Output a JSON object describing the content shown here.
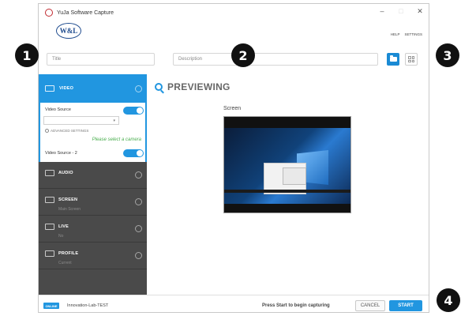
{
  "window": {
    "title": "YuJa Software Capture",
    "controls": {
      "minimize": "–",
      "maximize": "□",
      "close": "✕"
    }
  },
  "logo": {
    "text": "W&L"
  },
  "top_links": {
    "help": "HELP",
    "settings": "SETTINGS"
  },
  "fields": {
    "title_placeholder": "Title",
    "description_placeholder": "Description"
  },
  "sidebar": {
    "video": {
      "label": "VIDEO",
      "source_label": "Video Source",
      "source_enabled": true,
      "advanced_label": "ADVANCED SETTINGS",
      "camera_hint": "Please select a camera",
      "source2_label": "Video Source - 2",
      "source2_enabled": true
    },
    "audio": {
      "label": "AUDIO"
    },
    "screen": {
      "label": "SCREEN",
      "sub": "Main Screen"
    },
    "live": {
      "label": "LIVE",
      "sub": "No"
    },
    "profile": {
      "label": "PROFILE",
      "sub": "Current"
    }
  },
  "preview": {
    "heading": "PREVIEWING",
    "screen_label": "Screen"
  },
  "status": {
    "badge": "ONLINE",
    "device": "Innovation-Lab-TEST",
    "hint": "Press Start to begin capturing",
    "cancel": "CANCEL",
    "start": "START"
  },
  "markers": [
    "1",
    "2",
    "3",
    "4"
  ],
  "colors": {
    "accent": "#2196e0",
    "sidebar": "#4a4a4a",
    "hint": "#4caf50"
  }
}
